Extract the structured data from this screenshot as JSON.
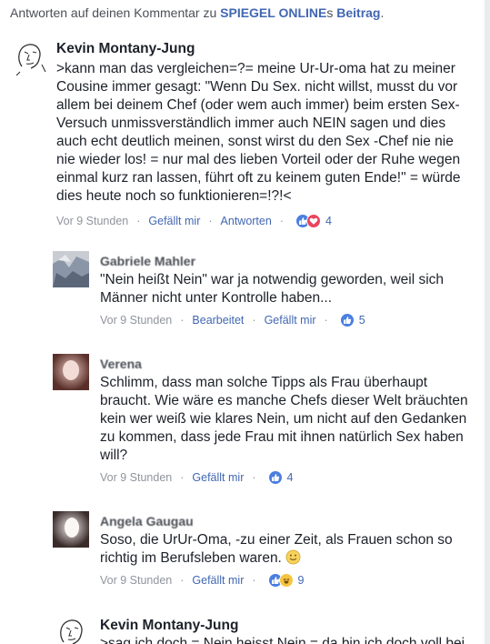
{
  "header": {
    "prefix": "Antworten auf deinen Kommentar zu ",
    "source_link": "SPIEGEL ONLINE",
    "possessive": "s ",
    "post_link": "Beitrag",
    "suffix": "."
  },
  "comments": [
    {
      "author": "Kevin Montany-Jung",
      "text": ">kann man das vergleichen=?= meine Ur-Ur-oma hat zu meiner Cousine immer gesagt: \"Wenn Du Sex. nicht willst, musst du vor allem  bei deinem Chef (oder wem auch immer) beim ersten Sex-Versuch unmissverständlich immer auch NEIN sagen und dies auch echt deutlich meinen, sonst wirst du den Sex -Chef nie nie nie wieder los! = nur mal des lieben Vorteil oder der Ruhe wegen einmal kurz ran lassen, führt oft zu keinem guten Ende!\" = würde dies heute noch so funktionieren=!?!<",
      "time": "Vor 9 Stunden",
      "like_label": "Gefällt mir",
      "reply_label": "Antworten",
      "reaction_count": "4",
      "reactions": [
        "like-icon",
        "love-icon"
      ]
    },
    {
      "author": "Gabriele Mahler",
      "text": "\"Nein heißt Nein\" war ja notwendig geworden, weil sich Männer nicht unter Kontrolle haben...",
      "time": "Vor 9 Stunden",
      "edited_label": "Bearbeitet",
      "like_label": "Gefällt mir",
      "reaction_count": "5",
      "reactions": [
        "like-icon"
      ]
    },
    {
      "author": "Verena",
      "text": "Schlimm, dass man solche Tipps als Frau überhaupt braucht.  Wie wäre es manche Chefs dieser Welt bräuchten kein wer weiß wie klares Nein, um nicht auf den Gedanken zu kommen, dass jede Frau mit ihnen natürlich Sex haben will?",
      "time": "Vor 9 Stunden",
      "like_label": "Gefällt mir",
      "reaction_count": "4",
      "reactions": [
        "like-icon"
      ]
    },
    {
      "author": "Angela Gaugau",
      "text": "Soso, die UrUr-Oma, -zu einer Zeit, als Frauen schon so richtig im Berufsleben waren.",
      "time": "Vor 9 Stunden",
      "like_label": "Gefällt mir",
      "reaction_count": "9",
      "reactions": [
        "like-icon",
        "haha-icon"
      ],
      "emoji": "smile-emoji-icon"
    },
    {
      "author": "Kevin Montany-Jung",
      "text": ">sag ich doch = Nein heisst Nein = da bin ich doch voll bei"
    }
  ],
  "colors": {
    "link": "#4267b2",
    "meta": "#90949c",
    "text": "#1d2129",
    "like": "#4a7fe0",
    "love": "#e9455e",
    "haha": "#f7c43e"
  }
}
